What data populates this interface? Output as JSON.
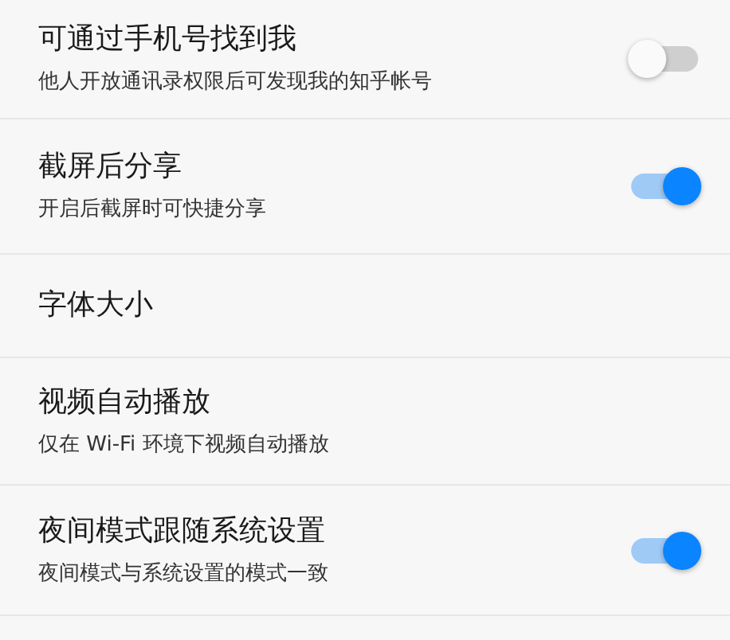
{
  "settings": [
    {
      "kind": "toggle",
      "title": "可通过手机号找到我",
      "subtitle": "他人开放通讯录权限后可发现我的知乎帐号",
      "on": false
    },
    {
      "kind": "toggle",
      "title": "截屏后分享",
      "subtitle": "开启后截屏时可快捷分享",
      "on": true
    },
    {
      "kind": "link",
      "title": "字体大小"
    },
    {
      "kind": "link",
      "title": "视频自动播放",
      "subtitle": "仅在 Wi-Fi 环境下视频自动播放"
    },
    {
      "kind": "toggle",
      "title": "夜间模式跟随系统设置",
      "subtitle": "夜间模式与系统设置的模式一致",
      "on": true
    }
  ]
}
